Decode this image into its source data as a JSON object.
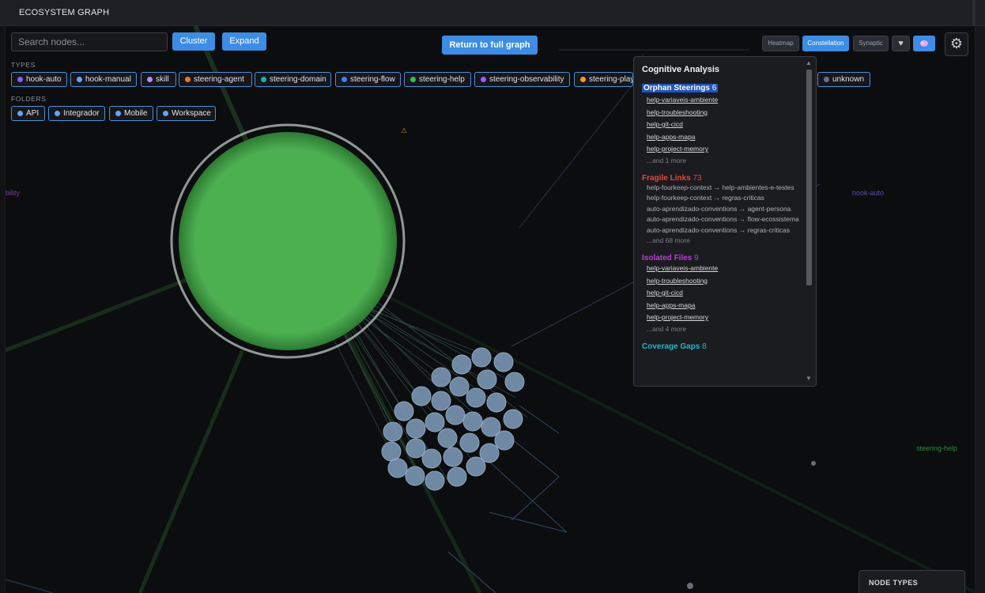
{
  "app": {
    "title": "ECOSYSTEM GRAPH"
  },
  "toolbar": {
    "search_placeholder": "Search nodes...",
    "cluster_label": "Cluster",
    "expand_label": "Expand",
    "return_label": "Return to full graph"
  },
  "types": {
    "label": "TYPES",
    "items": [
      {
        "label": "hook-auto",
        "color": "#8b5cf6"
      },
      {
        "label": "hook-manual",
        "color": "#60a5fa"
      },
      {
        "label": "skill",
        "color": "#c084fc"
      },
      {
        "label": "steering-agent",
        "color": "#f97316"
      },
      {
        "label": "steering-domain",
        "color": "#14b8a6"
      },
      {
        "label": "steering-flow",
        "color": "#3b82f6"
      },
      {
        "label": "steering-help",
        "color": "#22c55e"
      },
      {
        "label": "steering-observability",
        "color": "#a855f7"
      },
      {
        "label": "steering-play",
        "color": "#f59e0b"
      },
      {
        "label": "unknown",
        "color": "#64748b"
      }
    ]
  },
  "folders": {
    "label": "FOLDERS",
    "items": [
      {
        "label": "API",
        "color": "#60a5fa"
      },
      {
        "label": "Integrador",
        "color": "#60a5fa"
      },
      {
        "label": "Mobile",
        "color": "#60a5fa"
      },
      {
        "label": "Workspace",
        "color": "#60a5fa"
      }
    ]
  },
  "modes": {
    "heatmap": "Heatmap",
    "constellation": "Constellation",
    "synaptic": "Synaptic",
    "active": "Constellation"
  },
  "analysis": {
    "title": "Cognitive Analysis",
    "orphan": {
      "label": "Orphan Steerings",
      "count": "6",
      "items": [
        "help-variaveis-ambiente",
        "help-troubleshooting",
        "help-git-cicd",
        "help-apps-mapa",
        "help-project-memory"
      ],
      "more": "...and 1 more"
    },
    "fragile": {
      "label": "Fragile Links",
      "count": "73",
      "items": [
        "help-fourkeep-context → help-ambientes-e-testes",
        "help-fourkeep-context → regras-criticas",
        "auto-aprendizado-conventions → agent-persona",
        "auto-aprendizado-conventions → flow-ecossistema",
        "auto-aprendizado-conventions → regras-criticas"
      ],
      "more": "...and 68 more"
    },
    "isolated": {
      "label": "Isolated Files",
      "count": "9",
      "items": [
        "help-variaveis-ambiente",
        "help-troubleshooting",
        "help-git-cicd",
        "help-apps-mapa",
        "help-project-memory"
      ],
      "more": "...and 4 more"
    },
    "coverage": {
      "label": "Coverage Gaps",
      "count": "8"
    }
  },
  "canvas_labels": {
    "left": "bility",
    "hook_auto": "hook-auto",
    "steering_help": "steering-help",
    "warning": "⚠"
  },
  "node_types_panel": {
    "title": "NODE TYPES"
  },
  "colors": {
    "accent": "#3b8de6",
    "big_node": "#4caf50",
    "small_node": "#7a96b4"
  }
}
